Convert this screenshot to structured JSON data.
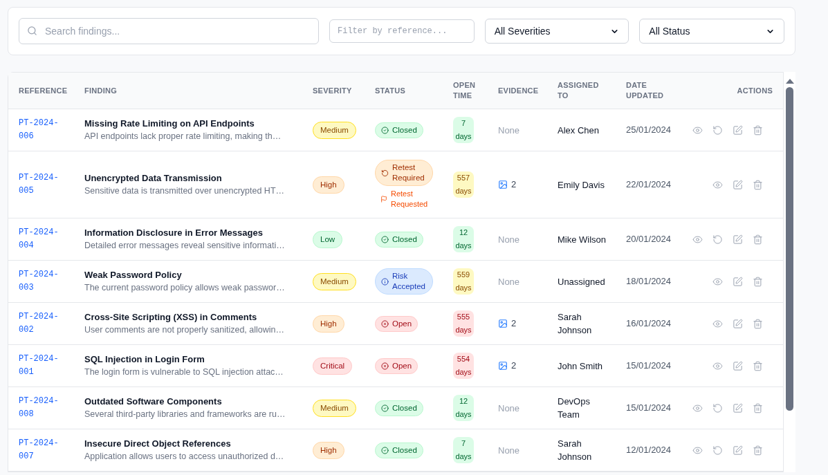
{
  "filters": {
    "search": {
      "placeholder": "Search findings..."
    },
    "reference": {
      "placeholder": "Filter by reference..."
    },
    "severity": {
      "value": "All Severities"
    },
    "status": {
      "value": "All Status"
    }
  },
  "table": {
    "columns": [
      "REFERENCE",
      "FINDING",
      "SEVERITY",
      "STATUS",
      "OPEN TIME",
      "EVIDENCE",
      "ASSIGNED TO",
      "DATE UPDATED",
      "ACTIONS"
    ],
    "rows": [
      {
        "reference": "PT-2024-006",
        "title": "Missing Rate Limiting on API Endpoints",
        "description": "API endpoints lack proper rate limiting, making th…",
        "severity": {
          "kind": "medium",
          "label": "Medium"
        },
        "status": {
          "kind": "closed",
          "label": "Closed"
        },
        "open_time": "7 days",
        "evidence": {
          "kind": "none",
          "text": "None"
        },
        "assigned": "Alex Chen",
        "date": "25/01/2024",
        "actions": [
          {
            "kind": "view"
          },
          {
            "kind": "retest"
          },
          {
            "kind": "edit"
          },
          {
            "kind": "delete"
          }
        ]
      },
      {
        "reference": "PT-2024-005",
        "title": "Unencrypted Data Transmission",
        "description": "Sensitive data is transmitted over unencrypted HT…",
        "severity": {
          "kind": "high",
          "label": "High"
        },
        "status": {
          "kind": "retest",
          "label": "Retest Required",
          "note": "Retest Requested"
        },
        "open_time": "557 days",
        "evidence": {
          "kind": "images",
          "text": "2"
        },
        "assigned": "Emily Davis",
        "date": "22/01/2024",
        "actions": [
          {
            "kind": "view"
          },
          {
            "kind": "edit"
          },
          {
            "kind": "delete"
          }
        ]
      },
      {
        "reference": "PT-2024-004",
        "title": "Information Disclosure in Error Messages",
        "description": "Detailed error messages reveal sensitive informati…",
        "severity": {
          "kind": "low",
          "label": "Low"
        },
        "status": {
          "kind": "closed",
          "label": "Closed"
        },
        "open_time": "12 days",
        "evidence": {
          "kind": "none",
          "text": "None"
        },
        "assigned": "Mike Wilson",
        "date": "20/01/2024",
        "actions": [
          {
            "kind": "view"
          },
          {
            "kind": "retest"
          },
          {
            "kind": "edit"
          },
          {
            "kind": "delete"
          }
        ]
      },
      {
        "reference": "PT-2024-003",
        "title": "Weak Password Policy",
        "description": "The current password policy allows weak passwor…",
        "severity": {
          "kind": "medium",
          "label": "Medium"
        },
        "status": {
          "kind": "accepted",
          "label": "Risk Accepted"
        },
        "open_time": "559 days",
        "evidence": {
          "kind": "none",
          "text": "None"
        },
        "assigned": "Unassigned",
        "date": "18/01/2024",
        "actions": [
          {
            "kind": "view"
          },
          {
            "kind": "edit"
          },
          {
            "kind": "delete"
          }
        ]
      },
      {
        "reference": "PT-2024-002",
        "title": "Cross-Site Scripting (XSS) in Comments",
        "description": "User comments are not properly sanitized, allowin…",
        "severity": {
          "kind": "high",
          "label": "High"
        },
        "status": {
          "kind": "open",
          "label": "Open"
        },
        "open_time": "555 days",
        "evidence": {
          "kind": "images",
          "text": "2"
        },
        "assigned": "Sarah Johnson",
        "date": "16/01/2024",
        "actions": [
          {
            "kind": "view"
          },
          {
            "kind": "edit"
          },
          {
            "kind": "delete"
          }
        ]
      },
      {
        "reference": "PT-2024-001",
        "title": "SQL Injection in Login Form",
        "description": "The login form is vulnerable to SQL injection attac…",
        "severity": {
          "kind": "critical",
          "label": "Critical"
        },
        "status": {
          "kind": "open",
          "label": "Open"
        },
        "open_time": "554 days",
        "evidence": {
          "kind": "images",
          "text": "2"
        },
        "assigned": "John Smith",
        "date": "15/01/2024",
        "actions": [
          {
            "kind": "view"
          },
          {
            "kind": "edit"
          },
          {
            "kind": "delete"
          }
        ]
      },
      {
        "reference": "PT-2024-008",
        "title": "Outdated Software Components",
        "description": "Several third-party libraries and frameworks are ru…",
        "severity": {
          "kind": "medium",
          "label": "Medium"
        },
        "status": {
          "kind": "closed",
          "label": "Closed"
        },
        "open_time": "12 days",
        "evidence": {
          "kind": "none",
          "text": "None"
        },
        "assigned": "DevOps Team",
        "date": "15/01/2024",
        "actions": [
          {
            "kind": "view"
          },
          {
            "kind": "retest"
          },
          {
            "kind": "edit"
          },
          {
            "kind": "delete"
          }
        ]
      },
      {
        "reference": "PT-2024-007",
        "title": "Insecure Direct Object References",
        "description": "Application allows users to access unauthorized d…",
        "severity": {
          "kind": "high",
          "label": "High"
        },
        "status": {
          "kind": "closed",
          "label": "Closed"
        },
        "open_time": "7 days",
        "evidence": {
          "kind": "none",
          "text": "None"
        },
        "assigned": "Sarah Johnson",
        "date": "12/01/2024",
        "actions": [
          {
            "kind": "view"
          },
          {
            "kind": "retest"
          },
          {
            "kind": "edit"
          },
          {
            "kind": "delete"
          }
        ]
      }
    ]
  }
}
